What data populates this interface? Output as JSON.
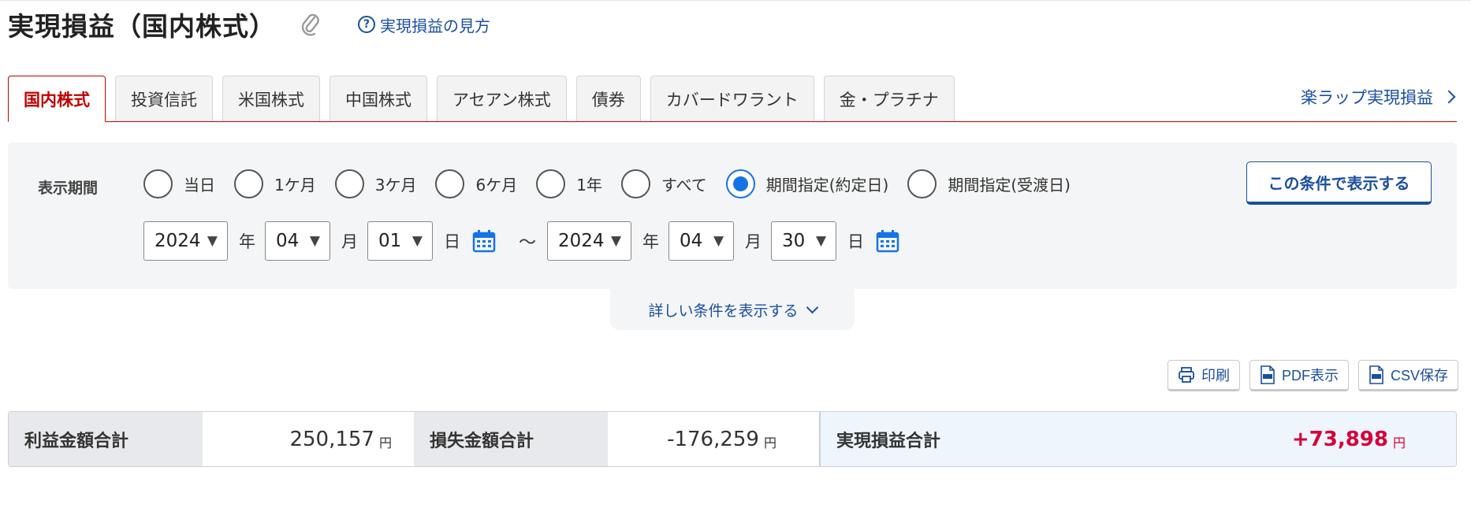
{
  "header": {
    "title": "実現損益（国内株式）",
    "help_link": "実現損益の見方"
  },
  "tabs": [
    {
      "label": "国内株式",
      "active": true
    },
    {
      "label": "投資信託",
      "active": false
    },
    {
      "label": "米国株式",
      "active": false
    },
    {
      "label": "中国株式",
      "active": false
    },
    {
      "label": "アセアン株式",
      "active": false
    },
    {
      "label": "債券",
      "active": false
    },
    {
      "label": "カバードワラント",
      "active": false
    },
    {
      "label": "金・プラチナ",
      "active": false
    }
  ],
  "wrap_link": "楽ラップ実現損益",
  "conditions": {
    "period_label": "表示期間",
    "options": [
      {
        "label": "当日",
        "checked": false
      },
      {
        "label": "1ケ月",
        "checked": false
      },
      {
        "label": "3ケ月",
        "checked": false
      },
      {
        "label": "6ケ月",
        "checked": false
      },
      {
        "label": "1年",
        "checked": false
      },
      {
        "label": "すべて",
        "checked": false
      },
      {
        "label": "期間指定(約定日)",
        "checked": true
      },
      {
        "label": "期間指定(受渡日)",
        "checked": false
      }
    ],
    "submit_label": "この条件で表示する",
    "from": {
      "year": "2024",
      "month": "04",
      "day": "01"
    },
    "to": {
      "year": "2024",
      "month": "04",
      "day": "30"
    },
    "units": {
      "year": "年",
      "month": "月",
      "day": "日"
    },
    "separator": "～",
    "more_label": "詳しい条件を表示する"
  },
  "actions": {
    "print": "印刷",
    "pdf": "PDF表示",
    "csv": "CSV保存"
  },
  "summary": {
    "profit_label": "利益金額合計",
    "profit_value": "250,157",
    "loss_label": "損失金額合計",
    "loss_value": "-176,259",
    "total_label": "実現損益合計",
    "total_value": "+73,898",
    "currency": "円"
  },
  "colors": {
    "accent_red": "#bf0000",
    "link_blue": "#1a4f9c",
    "radio_blue": "#1673e6",
    "profit_red": "#d50037"
  }
}
